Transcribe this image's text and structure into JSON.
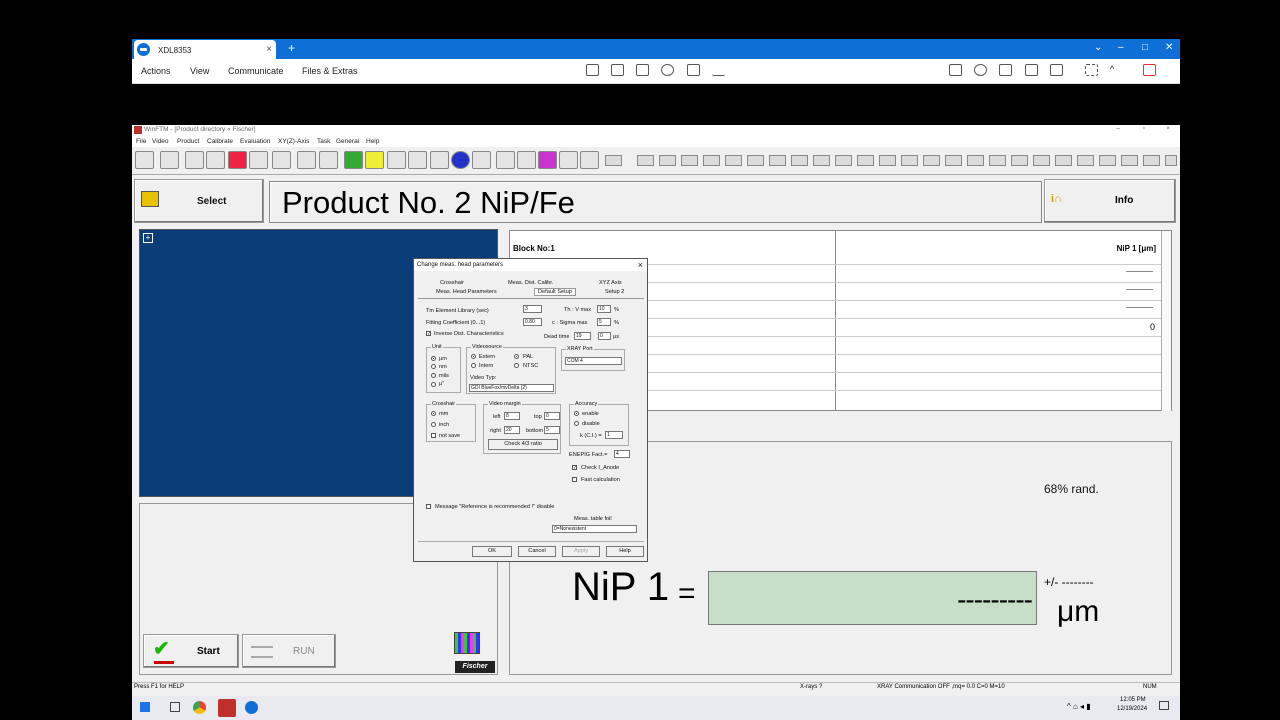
{
  "remote": {
    "tab_title": "XDL8353",
    "menu": [
      "Actions",
      "View",
      "Communicate",
      "Files & Extras"
    ]
  },
  "app": {
    "title": "WinFTM - [Product directory « Fischer]",
    "menu": [
      "File",
      "Video",
      "Product",
      "Calibrate",
      "Evaluation",
      "XY(Z)-Axis",
      "Task",
      "General",
      "Help"
    ]
  },
  "select_label": "Select",
  "product_title": "Product No. 2  NiP/Fe",
  "info_label": "Info",
  "table": {
    "block": "Block No:1",
    "col": "NiP 1 [μm]",
    "dashes": [
      "______",
      "______",
      "______"
    ],
    "zero": "0"
  },
  "result": {
    "rand": "68% rand.",
    "name": "NiP 1",
    "eq": "=",
    "value": "---------",
    "pm": "+/- --------",
    "unit": "μm"
  },
  "start_label": "Start",
  "run_label": "RUN",
  "fischer": "Fischer",
  "status": {
    "help": "Press F1 for HELP",
    "xrays": "X-rays ?",
    "comm": "XRAY Communication OFF ,mq= 0.0  C=0  M=10",
    "num": "NUM"
  },
  "dialog": {
    "title": "Change meas. head parameters",
    "tabs_row1": [
      "Crosshair",
      "Meas. Dist. Calibr.",
      "XYZ Axis"
    ],
    "tabs_row2": [
      "Meas. Head Parameters",
      "Default Setup",
      "Setup 2"
    ],
    "tm_label": "Tm Element Library (sec)",
    "tm_val": "3",
    "fit_label": "Fitting Coefficient (0...1)",
    "fit_val": "0.80",
    "inv_label": "Inverse Dist. Characteristics",
    "thv_label": "Th : V max",
    "thv_val": "10",
    "pct": "%",
    "sig_label": "c : Sigma max",
    "sig_val": "5",
    "dead_label": "Dead time",
    "dead_v1": "19",
    "dead_v2": "0",
    "dead_unit": "μs",
    "unit_title": "Unit",
    "units": [
      "μm",
      "nm",
      "mils",
      "μ''"
    ],
    "video_title": "Videosource",
    "extern": "Extern",
    "intern": "Intern",
    "pal": "PAL",
    "ntsc": "NTSC",
    "video_typ": "Video Typ:",
    "video_typ_val": "GDI BlueFox/mvDelta (2)",
    "xray_port": "XRAY Port",
    "xray_port_val": "COM 4",
    "cross_title": "Crosshair",
    "cross_mm": "mm",
    "cross_inch": "inch",
    "cross_notsave": "not save",
    "vm_title": "Video margin",
    "vm_left": "left",
    "vm_left_val": "8",
    "vm_top": "top",
    "vm_top_val": "0",
    "vm_right": "right",
    "vm_right_val": "20",
    "vm_bottom": "bottom",
    "vm_bottom_val": "5",
    "check_ratio": "Check 4/3 ratio",
    "acc_title": "Accuracy",
    "acc_enable": "enable",
    "acc_disable": "disable",
    "kci_label": "k (C.I.) =",
    "kci_val": "1",
    "enepig_label": "ENEPIG Fact.=",
    "enepig_val": "4",
    "check_ianode": "Check I_Anode",
    "fast_calc": "Fast calculation",
    "msg_label": "Message \"Reference is recommended !\" disable",
    "meas_table": "Meas. table foil",
    "meas_table_val": "0=Nonexistent",
    "ok": "OK",
    "cancel": "Cancel",
    "apply": "Apply",
    "help": "Help"
  },
  "taskbar": {
    "time": "12:05 PM",
    "date": "12/19/2024"
  }
}
